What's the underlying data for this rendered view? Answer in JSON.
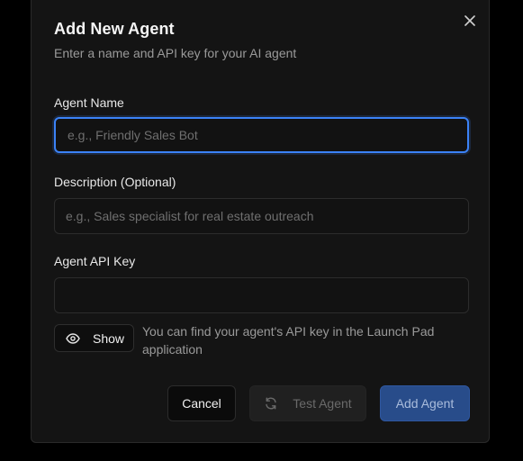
{
  "dialog": {
    "title": "Add New Agent",
    "subtitle": "Enter a name and API key for your AI agent",
    "close_icon": "close-icon"
  },
  "fields": {
    "name": {
      "label": "Agent Name",
      "placeholder": "e.g., Friendly Sales Bot",
      "value": ""
    },
    "description": {
      "label": "Description (Optional)",
      "placeholder": "e.g., Sales specialist for real estate outreach",
      "value": ""
    },
    "api_key": {
      "label": "Agent API Key",
      "placeholder": "",
      "value": ""
    }
  },
  "api_key_help": {
    "show_label": "Show",
    "show_icon": "eye-icon",
    "hint": "You can find your agent's API key in the Launch Pad application"
  },
  "footer": {
    "cancel_label": "Cancel",
    "test_label": "Test Agent",
    "test_icon": "refresh-icon",
    "add_label": "Add Agent"
  },
  "colors": {
    "focus_ring": "#3b82f6",
    "primary_button": "#284c8a",
    "background": "#141414"
  }
}
